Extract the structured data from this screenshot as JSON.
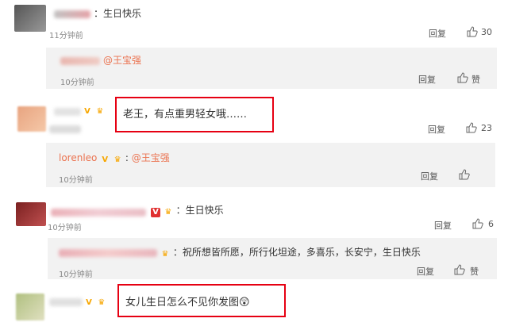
{
  "comments": [
    {
      "text": "：生日快乐",
      "time": "11分钟前",
      "reply_label": "回复",
      "likes": "30"
    },
    {
      "reply": {
        "mention": "@王宝强",
        "time": "10分钟前",
        "reply_label": "回复",
        "likes": "赞"
      }
    },
    {
      "text": "老王，有点重男轻女哦……",
      "time": "10分钟前",
      "reply_label": "回复",
      "likes": "23"
    },
    {
      "reply": {
        "username": "lorenleo",
        "mention": "@王宝强",
        "time": "10分钟前",
        "reply_label": "回复",
        "likes": "2"
      }
    },
    {
      "text": "：生日快乐",
      "time": "10分钟前",
      "reply_label": "回复",
      "likes": "6"
    },
    {
      "reply": {
        "text": "：祝所想皆所愿，所行化坦途，多喜乐，长安宁，生日快乐",
        "time": "10分钟前",
        "reply_label": "回复",
        "likes": "赞"
      }
    },
    {
      "text": "女儿生日怎么不见你发图",
      "emoji": "😲"
    }
  ],
  "colors": {
    "highlight": "#e60012",
    "mention": "#eb7350",
    "nested_bg": "#f2f2f2",
    "time": "#888888"
  },
  "icons": [
    "thumb-up-icon",
    "v-badge-icon",
    "crown-badge-icon"
  ]
}
